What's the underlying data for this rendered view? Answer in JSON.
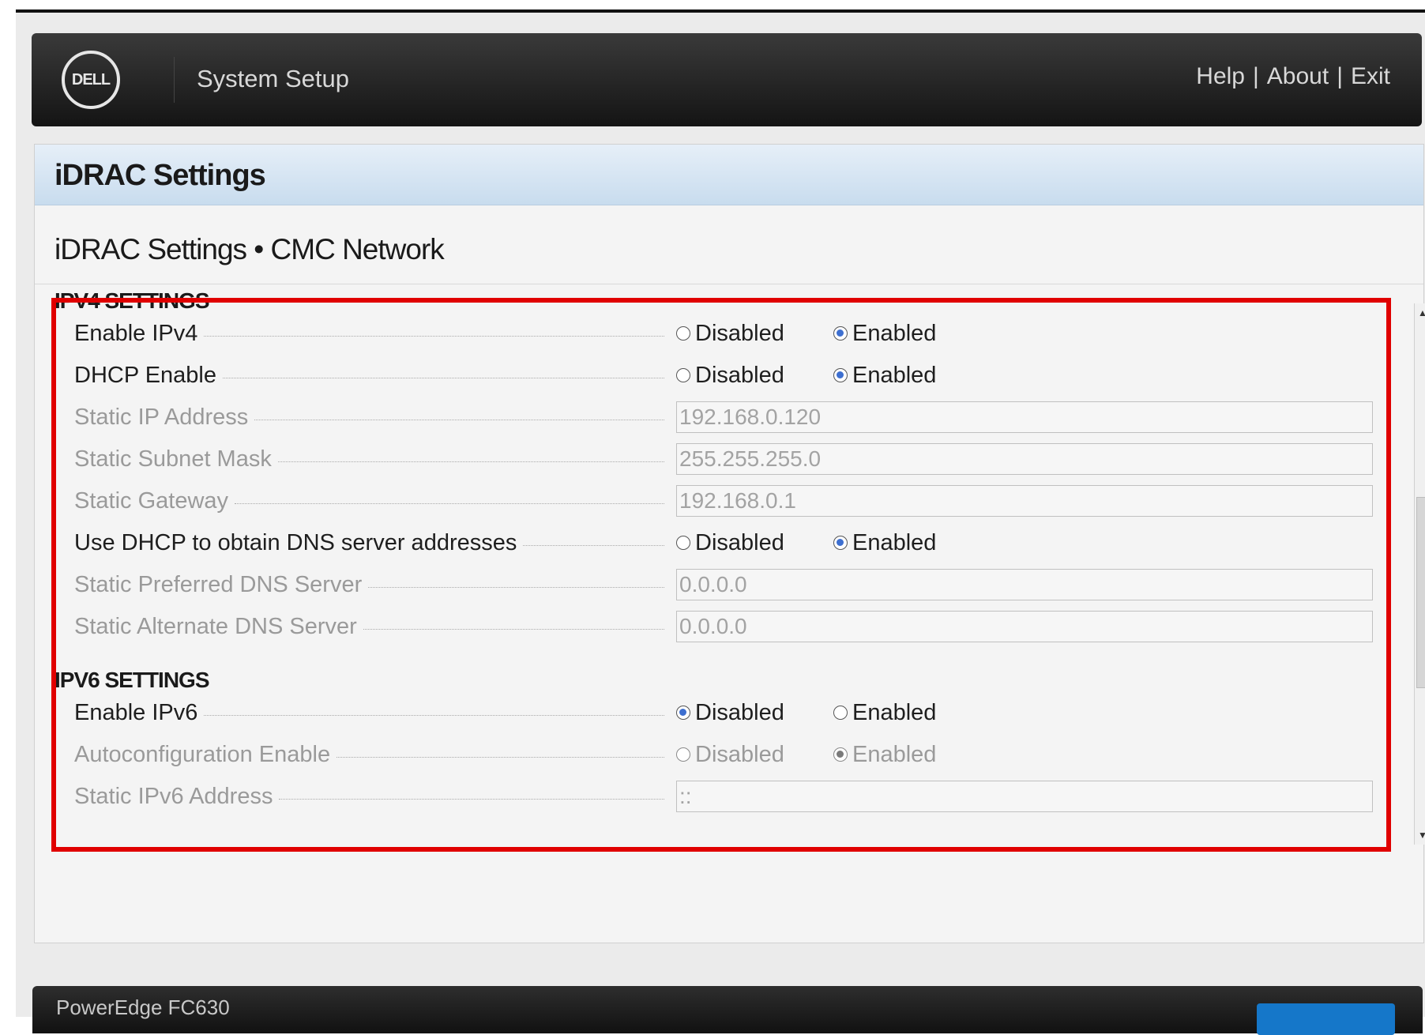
{
  "header": {
    "logo_text": "DELL",
    "app_title": "System Setup",
    "nav": [
      "Help",
      "About",
      "Exit"
    ],
    "nav_separator": "|"
  },
  "panel": {
    "title": "iDRAC Settings",
    "breadcrumb": "iDRAC Settings • CMC Network"
  },
  "ipv4": {
    "section_title": "IPV4 SETTINGS",
    "enable_ipv4": {
      "label": "Enable IPv4",
      "selected": "Enabled"
    },
    "dhcp_enable": {
      "label": "DHCP Enable",
      "selected": "Enabled"
    },
    "static_ip": {
      "label": "Static IP Address",
      "value": "192.168.0.120"
    },
    "static_subnet": {
      "label": "Static Subnet Mask",
      "value": "255.255.255.0"
    },
    "static_gateway": {
      "label": "Static Gateway",
      "value": "192.168.0.1"
    },
    "dhcp_dns": {
      "label": "Use DHCP to obtain DNS server addresses",
      "selected": "Enabled"
    },
    "preferred_dns": {
      "label": "Static Preferred DNS Server",
      "value": "0.0.0.0"
    },
    "alternate_dns": {
      "label": "Static Alternate DNS Server",
      "value": "0.0.0.0"
    }
  },
  "ipv6": {
    "section_title": "IPV6 SETTINGS",
    "enable_ipv6": {
      "label": "Enable IPv6",
      "selected": "Disabled"
    },
    "autoconfig": {
      "label": "Autoconfiguration Enable",
      "selected": "Enabled"
    },
    "static_ipv6": {
      "label": "Static IPv6 Address",
      "value": "::"
    }
  },
  "radio_options": {
    "disabled": "Disabled",
    "enabled": "Enabled"
  },
  "footer": {
    "model": "PowerEdge FC630"
  },
  "colors": {
    "highlight": "#e00000",
    "radio_selected": "#3d6fd0",
    "footer_button": "#1577c9"
  }
}
